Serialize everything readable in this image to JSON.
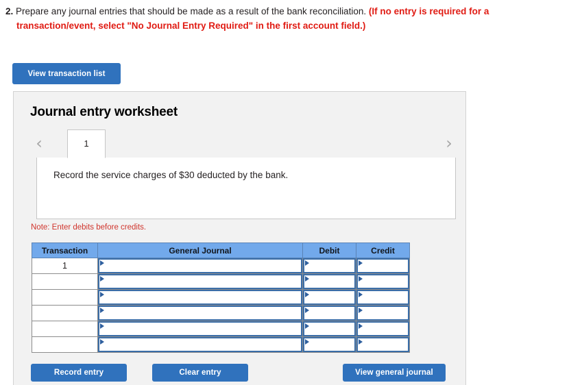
{
  "question": {
    "number": "2.",
    "line1_black": "Prepare any journal entries that should be made as a result of the bank reconciliation.",
    "line1_red": "(If no entry is required for a",
    "line2_red": "transaction/event, select \"No Journal Entry Required\" in the first account field.)"
  },
  "toolbar": {
    "view_transaction_list": "View transaction list"
  },
  "panel": {
    "title": "Journal entry worksheet",
    "prev_arrow": "‹",
    "next_arrow": "›",
    "tabs": [
      {
        "label": "1",
        "selected": true
      }
    ],
    "description": "Record the service charges of $30 deducted by the bank.",
    "note": "Note: Enter debits before credits."
  },
  "table": {
    "headers": [
      "Transaction",
      "General Journal",
      "Debit",
      "Credit"
    ],
    "rows": [
      {
        "transaction": "1",
        "general_journal": "",
        "debit": "",
        "credit": ""
      },
      {
        "transaction": "",
        "general_journal": "",
        "debit": "",
        "credit": ""
      },
      {
        "transaction": "",
        "general_journal": "",
        "debit": "",
        "credit": ""
      },
      {
        "transaction": "",
        "general_journal": "",
        "debit": "",
        "credit": ""
      },
      {
        "transaction": "",
        "general_journal": "",
        "debit": "",
        "credit": ""
      },
      {
        "transaction": "",
        "general_journal": "",
        "debit": "",
        "credit": ""
      }
    ]
  },
  "footer": {
    "record_entry": "Record entry",
    "clear_entry": "Clear entry",
    "view_general_journal": "View general journal"
  },
  "colors": {
    "button_blue": "#3072bd",
    "header_blue": "#72a9eb",
    "note_red": "#d0342c",
    "prompt_red": "#e01b13",
    "panel_bg": "#f2f2f2",
    "field_border": "#3b6ea8"
  }
}
